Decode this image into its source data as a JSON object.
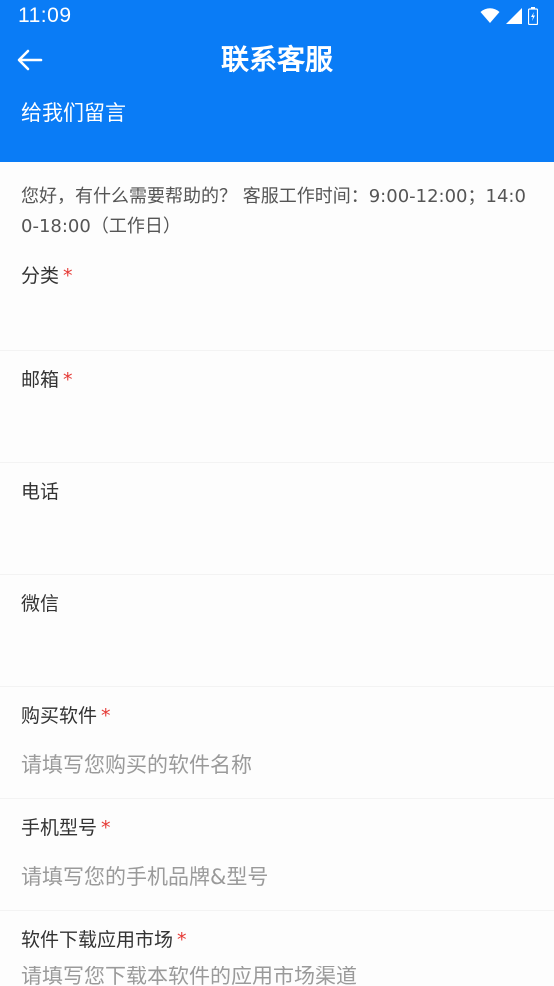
{
  "status_bar": {
    "time": "11:09",
    "icons": [
      "wifi-icon",
      "signal-icon",
      "battery-icon"
    ]
  },
  "header": {
    "title": "联系客服",
    "subtitle": "给我们留言",
    "background_color": "#0a7cf6"
  },
  "intro": "您好，有什么需要帮助的？ 客服工作时间：9:00-12:00；14:00-18:00（工作日）",
  "required_mark": "*",
  "fields": [
    {
      "label": "分类",
      "required": true,
      "placeholder": ""
    },
    {
      "label": "邮箱",
      "required": true,
      "placeholder": ""
    },
    {
      "label": "电话",
      "required": false,
      "placeholder": ""
    },
    {
      "label": "微信",
      "required": false,
      "placeholder": ""
    },
    {
      "label": "购买软件",
      "required": true,
      "placeholder": "请填写您购买的软件名称"
    },
    {
      "label": "手机型号",
      "required": true,
      "placeholder": "请填写您的手机品牌&型号"
    },
    {
      "label": "软件下载应用市场",
      "required": true,
      "placeholder": "请填写您下载本软件的应用市场渠道"
    }
  ]
}
